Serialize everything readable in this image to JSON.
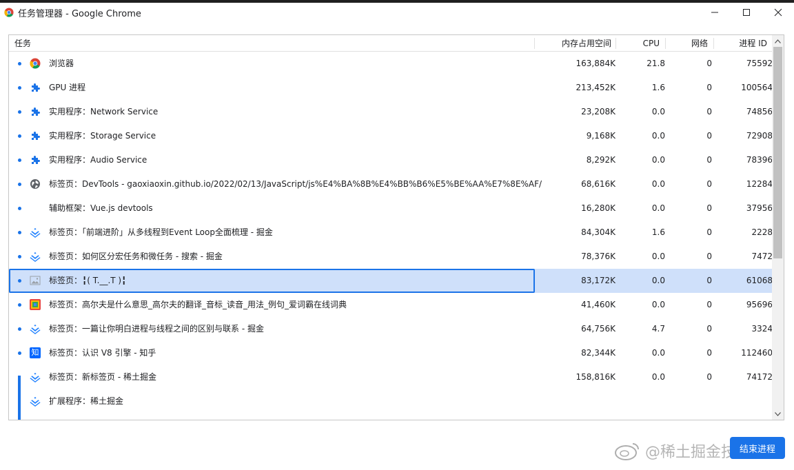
{
  "window": {
    "title": "任务管理器 - Google Chrome",
    "controls": [
      "minimize-icon",
      "maximize-icon",
      "close-icon"
    ]
  },
  "columns": {
    "task": "任务",
    "memory": "内存占用空间",
    "cpu": "CPU",
    "network": "网络",
    "pid": "进程 ID"
  },
  "rows": [
    {
      "icon": "chrome-icon",
      "name": "浏览器",
      "memory": "163,884K",
      "cpu": "21.8",
      "network": "0",
      "pid": "75592"
    },
    {
      "icon": "puzzle-icon",
      "name": "GPU 进程",
      "memory": "213,452K",
      "cpu": "1.6",
      "network": "0",
      "pid": "100564"
    },
    {
      "icon": "puzzle-icon",
      "name": "实用程序：Network Service",
      "memory": "23,208K",
      "cpu": "0.0",
      "network": "0",
      "pid": "74856"
    },
    {
      "icon": "puzzle-icon",
      "name": "实用程序：Storage Service",
      "memory": "9,168K",
      "cpu": "0.0",
      "network": "0",
      "pid": "72908"
    },
    {
      "icon": "puzzle-icon",
      "name": "实用程序：Audio Service",
      "memory": "8,292K",
      "cpu": "0.0",
      "network": "0",
      "pid": "78396"
    },
    {
      "icon": "globe-icon",
      "name": "标签页：DevTools - gaoxiaoxin.github.io/2022/02/13/JavaScript/js%E4%BA%8B%E4%BB%B6%E5%BE%AA%E7%8E%AF/",
      "memory": "68,616K",
      "cpu": "0.0",
      "network": "0",
      "pid": "12284"
    },
    {
      "icon": "none",
      "name": "辅助框架：Vue.js devtools",
      "memory": "16,280K",
      "cpu": "0.0",
      "network": "0",
      "pid": "37956"
    },
    {
      "icon": "juejin-icon",
      "name": "标签页：「前端进阶」从多线程到Event Loop全面梳理 - 掘金",
      "memory": "84,304K",
      "cpu": "1.6",
      "network": "0",
      "pid": "2228"
    },
    {
      "icon": "juejin-icon",
      "name": "标签页：如何区分宏任务和微任务 - 搜索 - 掘金",
      "memory": "78,376K",
      "cpu": "0.0",
      "network": "0",
      "pid": "7472"
    },
    {
      "icon": "image-placeholder-icon",
      "name": "标签页：╏( T.__.T )╏",
      "memory": "83,172K",
      "cpu": "0.0",
      "network": "0",
      "pid": "61068",
      "selected": true
    },
    {
      "icon": "dictionary-icon",
      "name": "标签页：高尔夫是什么意思_高尔夫的翻译_音标_读音_用法_例句_爱词霸在线词典",
      "memory": "41,460K",
      "cpu": "0.0",
      "network": "0",
      "pid": "95696"
    },
    {
      "icon": "juejin-icon",
      "name": "标签页：一篇让你明白进程与线程之间的区别与联系 - 掘金",
      "memory": "64,756K",
      "cpu": "4.7",
      "network": "0",
      "pid": "3324"
    },
    {
      "icon": "zhihu-icon",
      "name": "标签页：认识 V8 引擎 - 知乎",
      "memory": "82,344K",
      "cpu": "0.0",
      "network": "0",
      "pid": "112460"
    },
    {
      "icon": "juejin-icon",
      "name": "标签页：新标签页 - 稀土掘金",
      "memory": "158,816K",
      "cpu": "0.0",
      "network": "0",
      "pid": "74172"
    },
    {
      "icon": "juejin-icon",
      "name": "扩展程序：稀土掘金",
      "memory": "",
      "cpu": "",
      "network": "",
      "pid": ""
    }
  ],
  "zhihu_glyph": "知",
  "end_button": "结束进程",
  "watermark": "@稀土掘金技术社区",
  "colors": {
    "accent": "#1a73e8",
    "selected_row": "#cfe0fa"
  }
}
